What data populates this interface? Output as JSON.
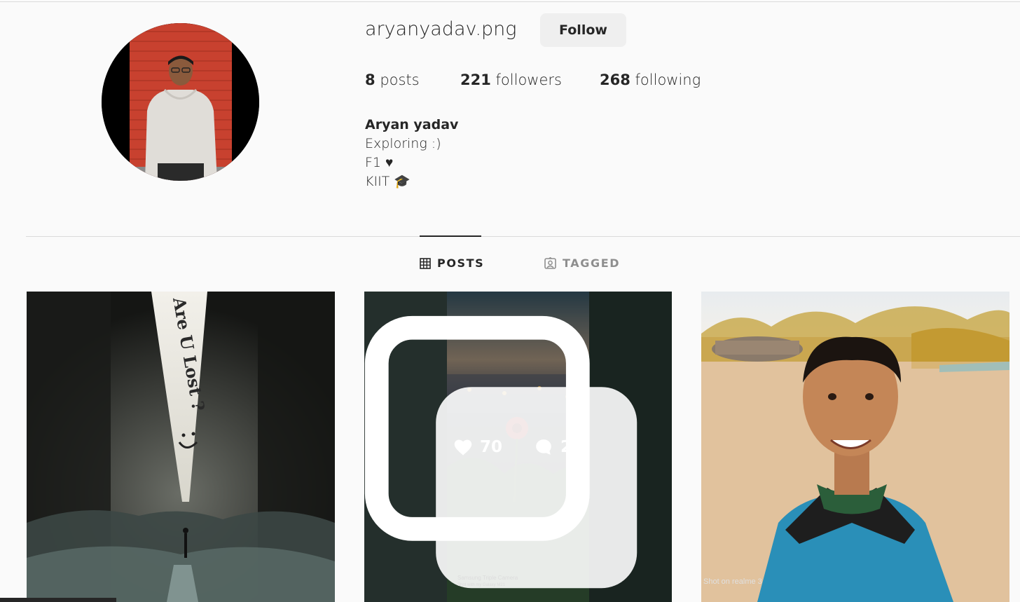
{
  "profile": {
    "username": "aryanyadav.png",
    "follow_label": "Follow",
    "stats": {
      "posts_count": "8",
      "posts_label": "posts",
      "followers_count": "221",
      "followers_label": "followers",
      "following_count": "268",
      "following_label": "following"
    },
    "bio": {
      "name": "Aryan yadav",
      "lines": [
        "Exploring :)",
        "F1 ♥",
        "KIIT 🎓"
      ]
    }
  },
  "tabs": [
    {
      "label": "POSTS",
      "icon": "grid-icon",
      "active": true
    },
    {
      "label": "TAGGED",
      "icon": "tagged-icon",
      "active": false
    }
  ],
  "posts": [
    {
      "image": "are-u-lost-poster",
      "caption_text": "Are U Lost ?"
    },
    {
      "image": "red-flower-city-dusk",
      "likes": "70",
      "comments": "20",
      "multi": true,
      "watermark": "Samsung Triple Camera",
      "watermark_sub": "Shot with my Galaxy M21"
    },
    {
      "image": "selfie-park",
      "watermark": "Shot on realme 3"
    }
  ],
  "colors": {
    "background": "#fafafa",
    "text": "#262626",
    "muted": "#8e8e8e",
    "button_bg": "#efefef",
    "divider": "#dbdbdb"
  }
}
